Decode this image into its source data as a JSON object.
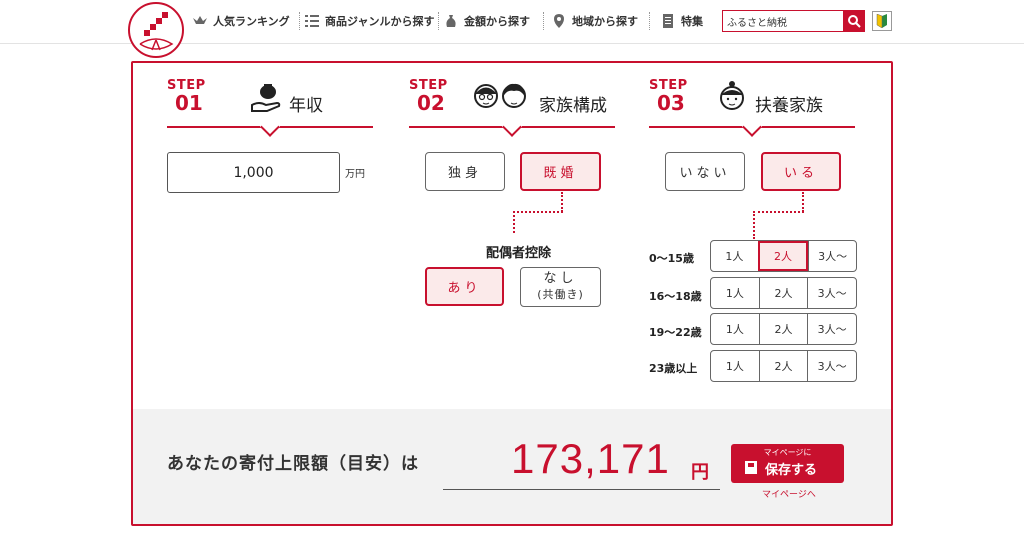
{
  "header": {
    "nav": [
      {
        "label": "人気ランキング",
        "icon": "crown-icon"
      },
      {
        "label": "商品ジャンルから探す",
        "icon": "list-icon"
      },
      {
        "label": "金額から探す",
        "icon": "money-bag-icon"
      },
      {
        "label": "地域から探す",
        "icon": "map-pin-icon"
      },
      {
        "label": "特集",
        "icon": "document-icon"
      }
    ],
    "search_value": "ふるさと納税"
  },
  "steps": {
    "step1": {
      "word": "STEP",
      "num": "01",
      "title": "年収",
      "income_value": "1,000",
      "income_unit": "万円"
    },
    "step2": {
      "word": "STEP",
      "num": "02",
      "title": "家族構成",
      "options": [
        "独身",
        "既婚"
      ],
      "selected": "既婚",
      "spouse_label": "配偶者控除",
      "spouse_yes": "あり",
      "spouse_no_1": "なし",
      "spouse_no_2": "(共働き)",
      "spouse_selected": "あり"
    },
    "step3": {
      "word": "STEP",
      "num": "03",
      "title": "扶養家族",
      "options": [
        "いない",
        "いる"
      ],
      "selected": "いる",
      "rows": [
        {
          "label": "0〜15歳",
          "opts": [
            "1人",
            "2人",
            "3人〜"
          ],
          "selected": 1
        },
        {
          "label": "16〜18歳",
          "opts": [
            "1人",
            "2人",
            "3人〜"
          ],
          "selected": -1
        },
        {
          "label": "19〜22歳",
          "opts": [
            "1人",
            "2人",
            "3人〜"
          ],
          "selected": -1
        },
        {
          "label": "23歳以上",
          "opts": [
            "1人",
            "2人",
            "3人〜"
          ],
          "selected": -1
        }
      ]
    }
  },
  "result": {
    "label": "あなたの寄付上限額（目安）は",
    "amount": "173,171",
    "unit": "円",
    "save_sub": "マイページに",
    "save_main": "保存する",
    "mypage_link": "マイページへ"
  },
  "colors": {
    "accent": "#c8102e",
    "selected_bg": "#fbeaea"
  }
}
